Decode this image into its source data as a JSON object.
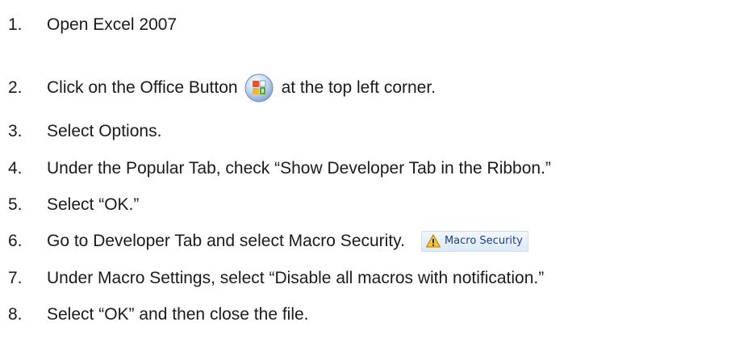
{
  "steps": [
    {
      "number": "1.",
      "text": "Open Excel 2007"
    },
    {
      "number": "2.",
      "text_before": "Click on the Office Button",
      "icon": "office-button-icon",
      "text_after": "at the top left corner."
    },
    {
      "number": "3.",
      "text": "Select Options."
    },
    {
      "number": "4.",
      "text": "Under the Popular Tab, check “Show Developer Tab in the Ribbon.”"
    },
    {
      "number": "5.",
      "text": "Select “OK.”"
    },
    {
      "number": "6.",
      "text": "Go to Developer Tab and select Macro Security.",
      "button_label": "Macro Security",
      "button_icon": "warning-shield-icon"
    },
    {
      "number": "7.",
      "text": "Under Macro Settings, select “Disable all macros with notification.”"
    },
    {
      "number": "8.",
      "text": "Select “OK” and then close the file."
    }
  ]
}
